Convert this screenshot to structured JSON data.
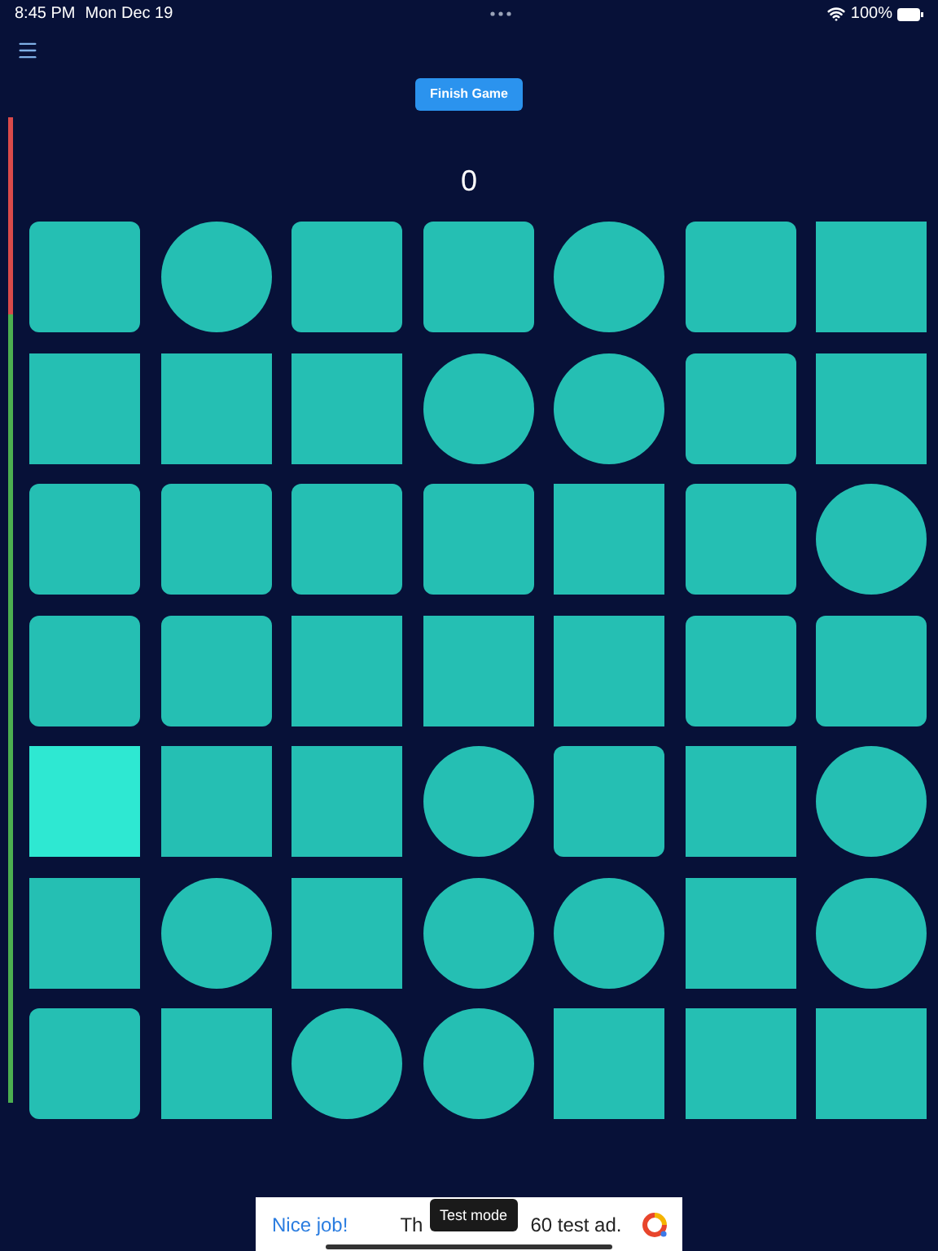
{
  "status_bar": {
    "time": "8:45 PM",
    "date": "Mon Dec 19",
    "battery": "100%"
  },
  "finish_button": "Finish Game",
  "score": "0",
  "timer": {
    "level": 0.8
  },
  "board": [
    [
      {
        "kind": "rounded",
        "selected": false
      },
      {
        "kind": "circle",
        "selected": false
      },
      {
        "kind": "rounded",
        "selected": false
      },
      {
        "kind": "rounded",
        "selected": false
      },
      {
        "kind": "circle",
        "selected": false
      },
      {
        "kind": "rounded",
        "selected": false
      },
      {
        "kind": "square",
        "selected": false
      }
    ],
    [
      {
        "kind": "square",
        "selected": false
      },
      {
        "kind": "square",
        "selected": false
      },
      {
        "kind": "square",
        "selected": false
      },
      {
        "kind": "circle",
        "selected": false
      },
      {
        "kind": "circle",
        "selected": false
      },
      {
        "kind": "rounded",
        "selected": false
      },
      {
        "kind": "square",
        "selected": false
      }
    ],
    [
      {
        "kind": "rounded",
        "selected": false
      },
      {
        "kind": "rounded",
        "selected": false
      },
      {
        "kind": "rounded",
        "selected": false
      },
      {
        "kind": "rounded",
        "selected": false
      },
      {
        "kind": "square",
        "selected": false
      },
      {
        "kind": "rounded",
        "selected": false
      },
      {
        "kind": "circle",
        "selected": false
      }
    ],
    [
      {
        "kind": "rounded",
        "selected": false
      },
      {
        "kind": "rounded",
        "selected": false
      },
      {
        "kind": "square",
        "selected": false
      },
      {
        "kind": "square",
        "selected": false
      },
      {
        "kind": "square",
        "selected": false
      },
      {
        "kind": "rounded",
        "selected": false
      },
      {
        "kind": "rounded",
        "selected": false
      }
    ],
    [
      {
        "kind": "square",
        "selected": true
      },
      {
        "kind": "square",
        "selected": false
      },
      {
        "kind": "square",
        "selected": false
      },
      {
        "kind": "circle",
        "selected": false
      },
      {
        "kind": "rounded",
        "selected": false
      },
      {
        "kind": "square",
        "selected": false
      },
      {
        "kind": "circle",
        "selected": false
      }
    ],
    [
      {
        "kind": "square",
        "selected": false
      },
      {
        "kind": "circle",
        "selected": false
      },
      {
        "kind": "square",
        "selected": false
      },
      {
        "kind": "circle",
        "selected": false
      },
      {
        "kind": "circle",
        "selected": false
      },
      {
        "kind": "square",
        "selected": false
      },
      {
        "kind": "circle",
        "selected": false
      }
    ],
    [
      {
        "kind": "rounded",
        "selected": false
      },
      {
        "kind": "square",
        "selected": false
      },
      {
        "kind": "circle",
        "selected": false
      },
      {
        "kind": "circle",
        "selected": false
      },
      {
        "kind": "square",
        "selected": false
      },
      {
        "kind": "square",
        "selected": false
      },
      {
        "kind": "square",
        "selected": false
      }
    ]
  ],
  "ad": {
    "headline": "Nice job!",
    "text_start": "Th",
    "text_end": "60 test ad.",
    "badge": "Test mode"
  }
}
